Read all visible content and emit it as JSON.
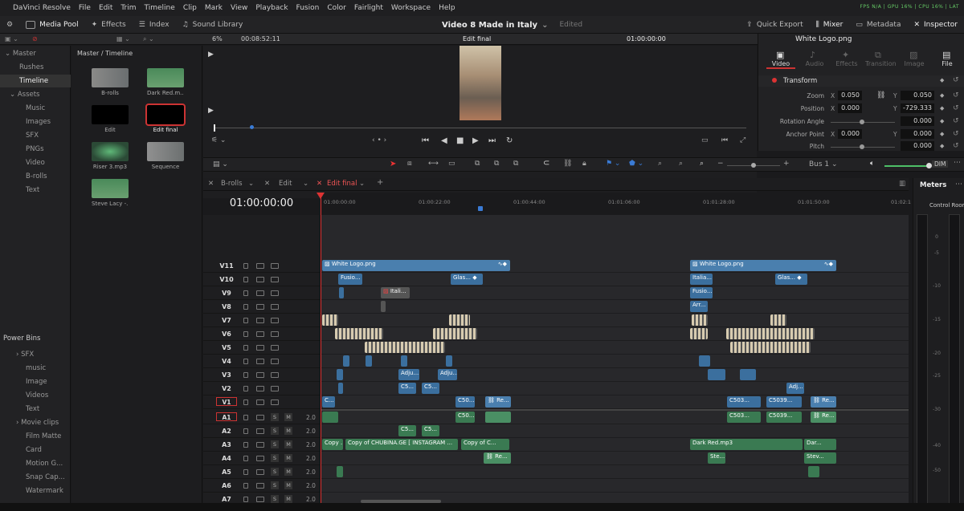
{
  "menu": {
    "app": "DaVinci Resolve",
    "items": [
      "File",
      "Edit",
      "Trim",
      "Timeline",
      "Clip",
      "Mark",
      "View",
      "Playback",
      "Fusion",
      "Color",
      "Fairlight",
      "Workspace",
      "Help"
    ],
    "stats": "FPS N/A | GPU 16% | CPU 16% | LAT"
  },
  "toolbar": {
    "media_pool": "Media Pool",
    "effects": "Effects",
    "index": "Index",
    "sound_library": "Sound Library",
    "project_title": "Video 8 Made in Italy",
    "project_status": "Edited",
    "quick_export": "Quick Export",
    "mixer": "Mixer",
    "metadata": "Metadata",
    "inspector": "Inspector"
  },
  "viewer": {
    "zoom": "6%",
    "duration": "00:08:52:11",
    "timeline_name": "Edit final",
    "timecode": "01:00:00:00"
  },
  "bins": {
    "items": [
      "Master",
      "Rushes",
      "Timeline",
      "Assets",
      "Music",
      "Images",
      "SFX",
      "PNGs",
      "Video",
      "B-rolls",
      "Text"
    ],
    "selected": "Timeline",
    "power_bins_title": "Power Bins",
    "power_items": [
      "SFX",
      "music",
      "Image",
      "Videos",
      "Text",
      "Movie clips",
      "Film Matte",
      "Card",
      "Motion G...",
      "Snap Cap...",
      "Watermark"
    ]
  },
  "media_pool": {
    "path": "Master / Timeline",
    "clips": [
      "B-rolls",
      "Dark Red.m...",
      "Edit",
      "Edit final",
      "Riser 3.mp3",
      "Sequence",
      "Steve Lacy -..."
    ]
  },
  "inspector": {
    "clip_name": "White Logo.png",
    "tabs": [
      "Video",
      "Audio",
      "Effects",
      "Transition",
      "Image",
      "File"
    ],
    "section": "Transform",
    "zoom_label": "Zoom",
    "zoom_x": "0.050",
    "zoom_y": "0.050",
    "position_label": "Position",
    "position_x": "0.000",
    "position_y": "-729.333",
    "rotation_label": "Rotation Angle",
    "rotation": "0.000",
    "anchor_label": "Anchor Point",
    "anchor_x": "0.000",
    "anchor_y": "0.000",
    "pitch_label": "Pitch",
    "pitch": "0.000",
    "x_axis": "X",
    "y_axis": "Y"
  },
  "timeline": {
    "tabs": [
      "B-rolls",
      "Edit",
      "Edit final"
    ],
    "active_tab": "Edit final",
    "timecode": "01:00:00:00",
    "bus": "Bus 1",
    "dim": "DIM",
    "ruler": [
      "01:00:00:00",
      "01:00:22:00",
      "01:00:44:00",
      "01:01:06:00",
      "01:01:28:00",
      "01:01:50:00",
      "01:02:1"
    ],
    "tracks": [
      "V11",
      "V10",
      "V9",
      "V8",
      "V7",
      "V6",
      "V5",
      "V4",
      "V3",
      "V2",
      "V1",
      "A1",
      "A2",
      "A3",
      "A4",
      "A5",
      "A6",
      "A7"
    ],
    "audio_volume": "2.0",
    "solo": "S",
    "mute": "M",
    "clips": {
      "white_logo": "White Logo.png",
      "fusion": "Fusio...",
      "glass": "Glas...",
      "itali": "Itali...",
      "italia": "Italia...",
      "arr": "Arr...",
      "adj": "Adju...",
      "adj2": "Adj...",
      "c5": "C5...",
      "c50": "C50...",
      "c503": "C503...",
      "c5039": "C5039...",
      "re": "Re...",
      "copy1": "Copy ...",
      "copy2": "Copy of CHUBINA.GE [ INSTAGRAM ...",
      "copy3": "Copy of C...",
      "dark_red": "Dark Red.mp3",
      "dar": "Dar...",
      "ste": "Ste...",
      "stev": "Stev...",
      "c": "C..."
    }
  },
  "meters": {
    "title": "Meters",
    "control_room": "Control Room",
    "scale": [
      "0",
      "-5",
      "-10",
      "-15",
      "-20",
      "-25",
      "-30",
      "-40",
      "-50"
    ]
  }
}
